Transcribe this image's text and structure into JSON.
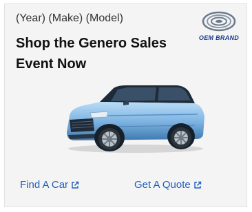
{
  "ad": {
    "vehicle_line": "(Year) (Make) (Model)",
    "headline": "Shop the Genero Sales Event Now",
    "brand_name": "OEM BRAND",
    "ctas": [
      {
        "label": "Find A Car",
        "icon": "external-link-icon"
      },
      {
        "label": "Get A Quote",
        "icon": "external-link-icon"
      }
    ]
  },
  "colors": {
    "card_background": "#f4f4f4",
    "link": "#1f5fbf",
    "brand": "#1a3d8f",
    "car_body": "#7fb5e3"
  }
}
